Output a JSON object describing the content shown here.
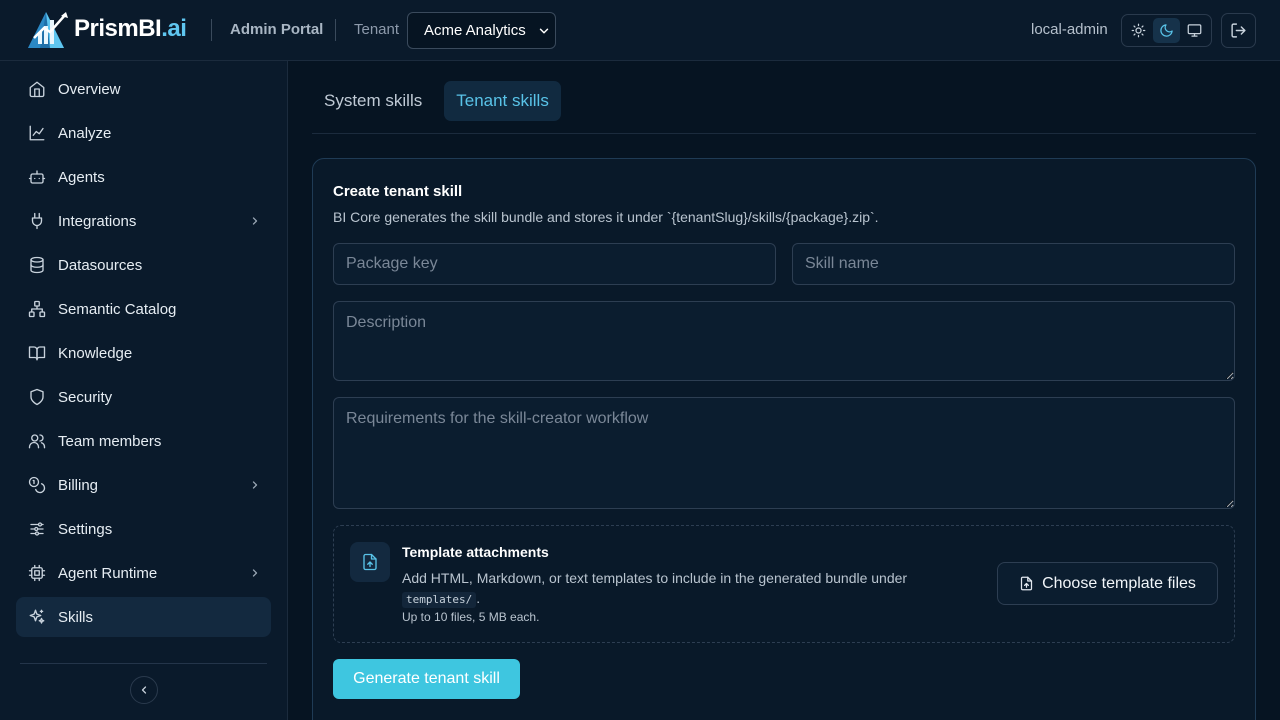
{
  "header": {
    "brand_main": "PrismBI",
    "brand_suffix": ".ai",
    "portal_label": "Admin Portal",
    "tenant_label": "Tenant",
    "tenant_selected": "Acme Analytics",
    "user_name": "local-admin",
    "theme_active": "dark"
  },
  "sidebar": {
    "items": [
      {
        "label": "Overview",
        "icon": "home-icon",
        "has_submenu": false,
        "active": false
      },
      {
        "label": "Analyze",
        "icon": "line-chart-icon",
        "has_submenu": false,
        "active": false
      },
      {
        "label": "Agents",
        "icon": "bot-icon",
        "has_submenu": false,
        "active": false
      },
      {
        "label": "Integrations",
        "icon": "plug-icon",
        "has_submenu": true,
        "active": false
      },
      {
        "label": "Datasources",
        "icon": "database-icon",
        "has_submenu": false,
        "active": false
      },
      {
        "label": "Semantic Catalog",
        "icon": "network-icon",
        "has_submenu": false,
        "active": false
      },
      {
        "label": "Knowledge",
        "icon": "book-icon",
        "has_submenu": false,
        "active": false
      },
      {
        "label": "Security",
        "icon": "shield-icon",
        "has_submenu": false,
        "active": false
      },
      {
        "label": "Team members",
        "icon": "users-icon",
        "has_submenu": false,
        "active": false
      },
      {
        "label": "Billing",
        "icon": "coins-icon",
        "has_submenu": true,
        "active": false
      },
      {
        "label": "Settings",
        "icon": "sliders-icon",
        "has_submenu": false,
        "active": false
      },
      {
        "label": "Agent Runtime",
        "icon": "cpu-icon",
        "has_submenu": true,
        "active": false
      },
      {
        "label": "Skills",
        "icon": "sparkles-icon",
        "has_submenu": false,
        "active": true
      }
    ]
  },
  "tabs": [
    {
      "label": "System skills",
      "active": false
    },
    {
      "label": "Tenant skills",
      "active": true
    }
  ],
  "form": {
    "title": "Create tenant skill",
    "subtitle": "BI Core generates the skill bundle and stores it under `{tenantSlug}/skills/{package}.zip`.",
    "package_key_placeholder": "Package key",
    "package_key_value": "",
    "skill_name_placeholder": "Skill name",
    "skill_name_value": "",
    "description_placeholder": "Description",
    "description_value": "",
    "requirements_placeholder": "Requirements for the skill-creator workflow",
    "requirements_value": ""
  },
  "attachments": {
    "title": "Template attachments",
    "description": "Add HTML, Markdown, or text templates to include in the generated bundle under",
    "path_code": "templates/",
    "path_suffix": ".",
    "limit": "Up to 10 files, 5 MB each.",
    "button_label": "Choose template files"
  },
  "generate_button": "Generate tenant skill",
  "colors": {
    "background": "#061422",
    "panel": "#0a1a2b",
    "accent": "#3ec6e0",
    "active_tab_text": "#59c3e8"
  }
}
